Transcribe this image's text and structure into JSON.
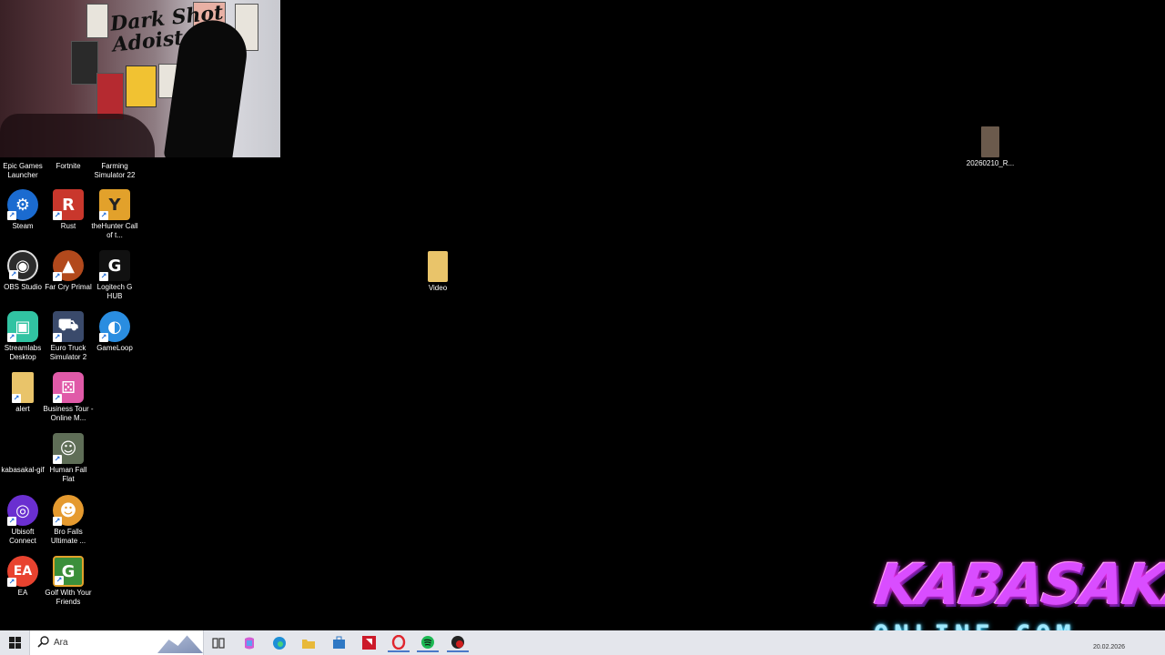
{
  "webcam": {
    "sign_text": "Dark Shot Adoist"
  },
  "desktop": {
    "icons": [
      {
        "label": "Epic Games Launcher",
        "icon": "epic-games-icon",
        "color": "#1a1a1a"
      },
      {
        "label": "Fortnite",
        "icon": "fortnite-icon",
        "color": "#3d2b6b"
      },
      {
        "label": "Farming Simulator 22",
        "icon": "farming-simulator-icon",
        "color": "#2e6b2a"
      },
      {
        "label": "Steam",
        "icon": "steam-icon",
        "color": "#1b6bd0"
      },
      {
        "label": "Rust",
        "icon": "rust-icon",
        "color": "#c9372c"
      },
      {
        "label": "theHunter Call of t...",
        "icon": "thehunter-icon",
        "color": "#e2a12b"
      },
      {
        "label": "OBS Studio",
        "icon": "obs-icon",
        "color": "#2b2b2b"
      },
      {
        "label": "Far Cry Primal",
        "icon": "far-cry-primal-icon",
        "color": "#b2491c"
      },
      {
        "label": "Logitech G HUB",
        "icon": "logitech-g-icon",
        "color": "#111111"
      },
      {
        "label": "Streamlabs Desktop",
        "icon": "streamlabs-icon",
        "color": "#31c3a2"
      },
      {
        "label": "Euro Truck Simulator 2",
        "icon": "euro-truck-icon",
        "color": "#3a4a6b"
      },
      {
        "label": "GameLoop",
        "icon": "gameloop-icon",
        "color": "#2a8de0"
      },
      {
        "label": "alert",
        "icon": "alert-icon",
        "color": "#e9c46a"
      },
      {
        "label": "Business Tour - Online M...",
        "icon": "business-tour-icon",
        "color": "#e05aa8"
      },
      {
        "label": "kabasakal-gif",
        "icon": "gif-file-icon",
        "color": "#000000"
      },
      {
        "label": "Human Fall Flat",
        "icon": "human-fall-flat-icon",
        "color": "#5f6e57"
      },
      {
        "label": "Ubisoft Connect",
        "icon": "ubisoft-icon",
        "color": "#6a2fd0"
      },
      {
        "label": "Bro Falls Ultimate ...",
        "icon": "bro-falls-icon",
        "color": "#e59a2f"
      },
      {
        "label": "EA",
        "icon": "ea-icon",
        "color": "#e8432f"
      },
      {
        "label": "Golf With Your Friends",
        "icon": "golf-with-friends-icon",
        "color": "#3b8f3a"
      },
      {
        "label": "Video",
        "icon": "folder-icon",
        "color": "#e9c46a"
      },
      {
        "label": "20260210_R...",
        "icon": "image-file-icon",
        "color": "#6b5a4c"
      }
    ]
  },
  "taskbar": {
    "search_placeholder": "Ara",
    "items": [
      {
        "name": "task-view",
        "icon": "task-view-icon",
        "color": "#333333"
      },
      {
        "name": "copilot",
        "icon": "copilot-icon",
        "color": "#d05ed4"
      },
      {
        "name": "edge",
        "icon": "edge-icon",
        "color": "#1d8fd6"
      },
      {
        "name": "file-explorer",
        "icon": "folder-icon",
        "color": "#e8b93a"
      },
      {
        "name": "store",
        "icon": "store-icon",
        "color": "#2f78c4"
      },
      {
        "name": "amd-software",
        "icon": "amd-icon",
        "color": "#cc1a2a"
      },
      {
        "name": "opera",
        "icon": "opera-icon",
        "color": "#e0262e"
      },
      {
        "name": "spotify",
        "icon": "spotify-icon",
        "color": "#1db954"
      },
      {
        "name": "recorder",
        "icon": "record-icon",
        "color": "#d01e1e"
      }
    ],
    "tray_date": "20.02.2026"
  },
  "overlay_logo": {
    "line1": "KABASAKAL",
    "line2": "ONLINE.COM"
  }
}
